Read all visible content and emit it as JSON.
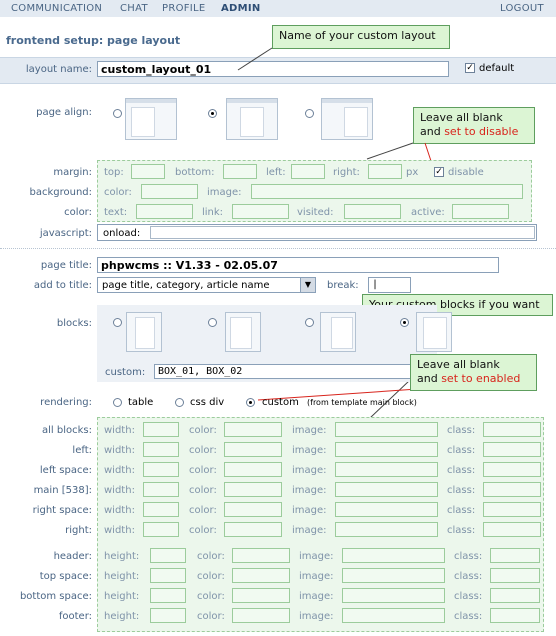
{
  "nav": {
    "communication": "COMMUNICATION",
    "chat": "CHAT",
    "profile": "PROFILE",
    "admin": "ADMIN",
    "logout": "LOGOUT"
  },
  "title": "frontend setup: page layout",
  "layout_name": {
    "label": "layout name:",
    "value": "custom_layout_01",
    "default_label": "default",
    "default_checked": true
  },
  "callouts": {
    "name": "Name of your custom layout",
    "blank_disable_line1": "Leave all blank",
    "blank_disable_and": "and ",
    "blank_disable_red": "set to disable",
    "blocks": "Your custom blocks if you want",
    "blank_enable_line1": "Leave all blank",
    "blank_enable_and": "and ",
    "blank_enable_red": "set to enabled"
  },
  "page_align": {
    "label": "page align:",
    "selected": 1
  },
  "margin": {
    "label": "margin:",
    "top": "top:",
    "bottom": "bottom:",
    "left": "left:",
    "right": "right:",
    "px": "px",
    "disable": "disable",
    "disable_checked": true
  },
  "background": {
    "label": "background:",
    "color": "color:",
    "image": "image:"
  },
  "color": {
    "label": "color:",
    "text": "text:",
    "link": "link:",
    "visited": "visited:",
    "active": "active:"
  },
  "javascript": {
    "label": "javascript:",
    "onload": "onload:"
  },
  "page_title": {
    "label": "page title:",
    "value": "phpwcms :: V1.33 - 02.05.07"
  },
  "add_to_title": {
    "label": "add to title:",
    "value": "page title, category, article name",
    "break_label": "break:",
    "break_value": "|"
  },
  "blocks": {
    "label": "blocks:",
    "selected": 3,
    "custom_label": "custom:",
    "custom_value": "BOX_01, BOX_02"
  },
  "rendering": {
    "label": "rendering:",
    "table": "table",
    "css": "css div",
    "custom": "custom",
    "custom_note": "(from template main block)",
    "selected": "custom"
  },
  "rows1": [
    {
      "label": "all blocks:"
    },
    {
      "label": "left:"
    },
    {
      "label": "left space:"
    },
    {
      "label": "main [538]:"
    },
    {
      "label": "right space:"
    },
    {
      "label": "right:"
    }
  ],
  "rows2": [
    {
      "label": "header:"
    },
    {
      "label": "top space:"
    },
    {
      "label": "bottom space:"
    },
    {
      "label": "footer:"
    }
  ],
  "fields1": {
    "width": "width:",
    "color": "color:",
    "image": "image:",
    "class": "class:"
  },
  "fields2": {
    "height": "height:",
    "color": "color:",
    "image": "image:",
    "class": "class:"
  }
}
